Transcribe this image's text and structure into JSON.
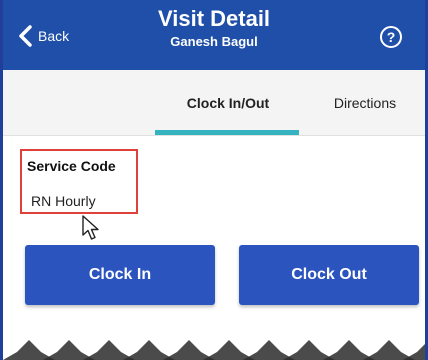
{
  "header": {
    "back_label": "Back",
    "title": "Visit Detail",
    "subtitle": "Ganesh Bagul",
    "help_icon": "help-circle-icon"
  },
  "tabs": [
    {
      "label": "Clock In/Out",
      "active": true
    },
    {
      "label": "Directions",
      "active": false
    }
  ],
  "service": {
    "label": "Service Code",
    "value": "RN Hourly"
  },
  "actions": {
    "clock_in_label": "Clock In",
    "clock_out_label": "Clock Out"
  },
  "colors": {
    "header_bg": "#1f4fa8",
    "tab_indicator": "#35b3c0",
    "button_bg": "#2b54bf",
    "highlight_border": "#e0403a"
  }
}
